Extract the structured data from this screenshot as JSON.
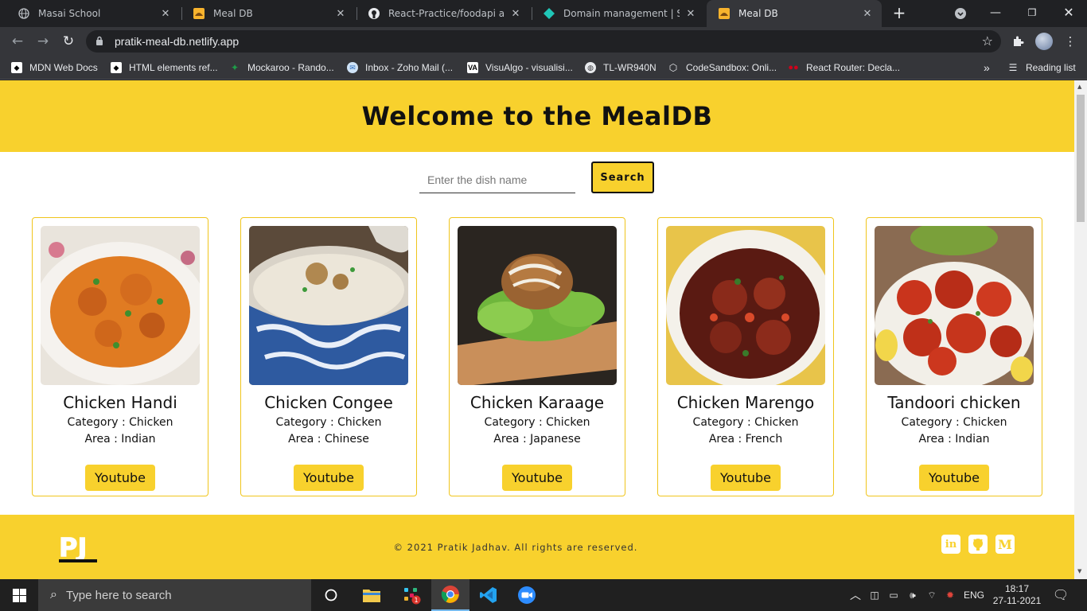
{
  "browser": {
    "tabs": [
      {
        "title": "Masai School",
        "icon": "globe-icon"
      },
      {
        "title": "Meal DB",
        "icon": "mealdb-icon"
      },
      {
        "title": "React-Practice/foodapi at ma",
        "icon": "github-icon"
      },
      {
        "title": "Domain management | Site s",
        "icon": "netlify-icon"
      },
      {
        "title": "Meal DB",
        "icon": "mealdb-icon",
        "active": true
      }
    ],
    "url": "pratik-meal-db.netlify.app",
    "bookmarks": [
      {
        "label": "MDN Web Docs"
      },
      {
        "label": "HTML elements ref..."
      },
      {
        "label": "Mockaroo - Rando..."
      },
      {
        "label": "Inbox - Zoho Mail (..."
      },
      {
        "label": "VisuAlgo - visualisi..."
      },
      {
        "label": "TL-WR940N"
      },
      {
        "label": "CodeSandbox: Onli..."
      },
      {
        "label": "React Router: Decla..."
      }
    ],
    "reading_list": "Reading list",
    "overflow": "»"
  },
  "page": {
    "heading": "Welcome to the MealDB",
    "search": {
      "placeholder": "Enter the dish name",
      "button": "Search"
    },
    "meals": [
      {
        "name": "Chicken Handi",
        "category": "Category : Chicken",
        "area": "Area : Indian",
        "button": "Youtube"
      },
      {
        "name": "Chicken Congee",
        "category": "Category : Chicken",
        "area": "Area : Chinese",
        "button": "Youtube"
      },
      {
        "name": "Chicken Karaage",
        "category": "Category : Chicken",
        "area": "Area : Japanese",
        "button": "Youtube"
      },
      {
        "name": "Chicken Marengo",
        "category": "Category : Chicken",
        "area": "Area : French",
        "button": "Youtube"
      },
      {
        "name": "Tandoori chicken",
        "category": "Category : Chicken",
        "area": "Area : Indian",
        "button": "Youtube"
      }
    ],
    "footer": {
      "logo": "PJ",
      "copyright": "© 2021 Pratik Jadhav. All rights are reserved.",
      "social": [
        "linkedin-icon",
        "github-icon",
        "medium-icon"
      ]
    },
    "colors": {
      "accent": "#f8d12d",
      "text": "#111111"
    }
  },
  "taskbar": {
    "search_placeholder": "Type here to search",
    "language": "ENG",
    "time": "18:17",
    "date": "27-11-2021",
    "slack_badge": "1"
  }
}
